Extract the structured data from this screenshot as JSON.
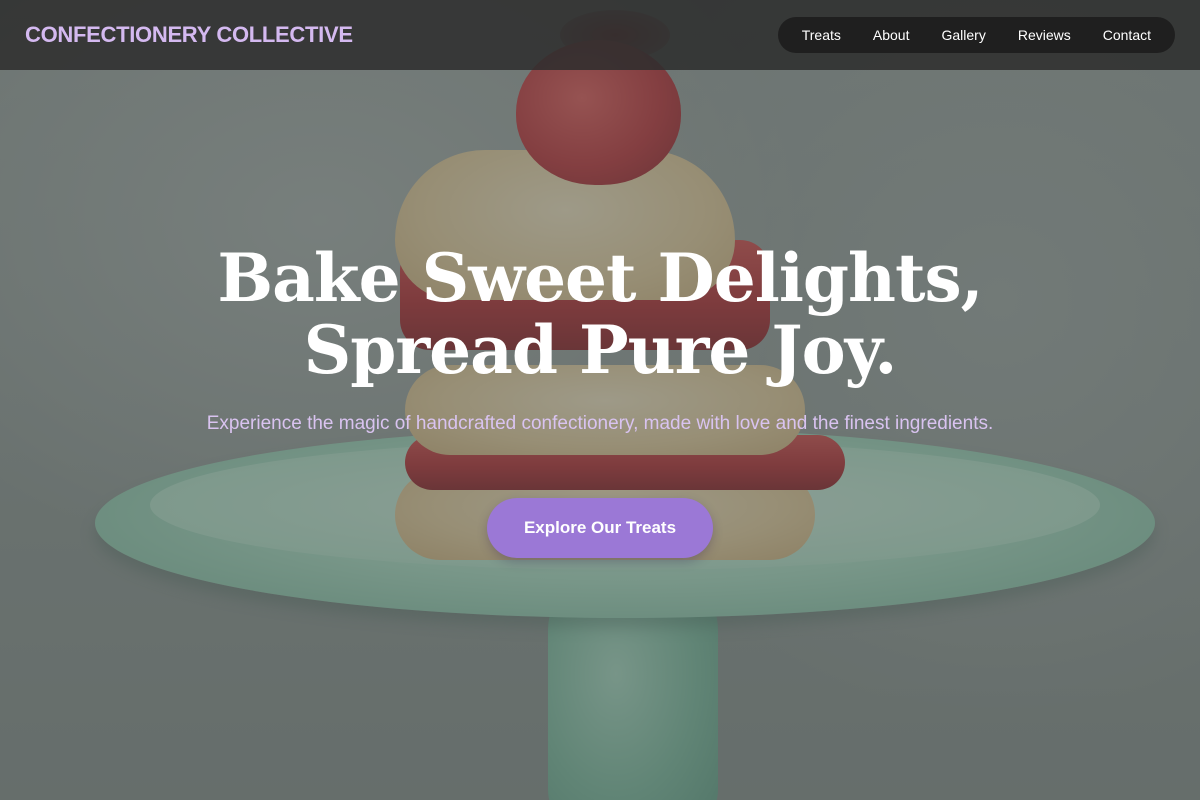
{
  "header": {
    "brand": "CONFECTIONERY COLLECTIVE",
    "nav": [
      {
        "label": "Treats"
      },
      {
        "label": "About"
      },
      {
        "label": "Gallery"
      },
      {
        "label": "Reviews"
      },
      {
        "label": "Contact"
      }
    ]
  },
  "hero": {
    "title_line1": "Bake Sweet Delights,",
    "title_line2": "Spread Pure Joy.",
    "subtitle": "Experience the magic of handcrafted confectionery, made with love and the finest ingredients.",
    "cta_label": "Explore Our Treats"
  },
  "colors": {
    "brand_text": "#d4b9f0",
    "accent_button": "#9b78d6",
    "subtitle_text": "#d9c3f0",
    "header_bg": "#2d2d2d",
    "nav_pill_bg": "#1f1f1f"
  },
  "background_image": {
    "subject": "strawberry shortcake on a mint-green cake stand"
  }
}
